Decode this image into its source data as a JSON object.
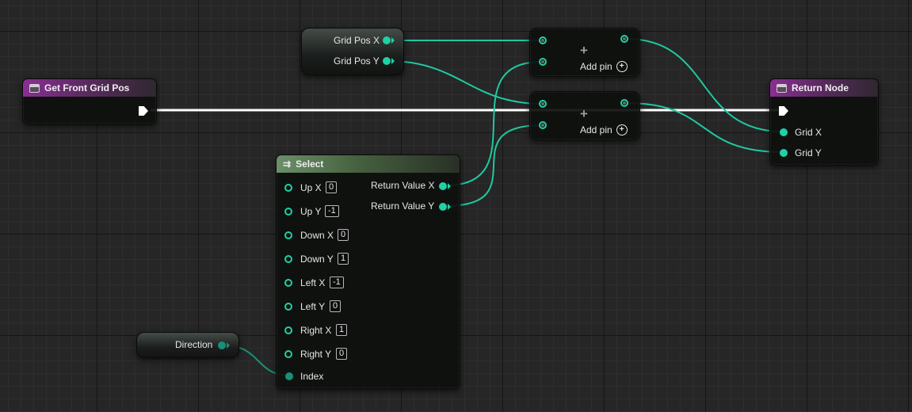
{
  "graph": {
    "colors": {
      "exec_wire": "#ffffff",
      "int_wire": "#1fc9a0",
      "function_header": "#8a2f93",
      "select_header": "#6b8f68"
    }
  },
  "nodes": {
    "get_front_grid_pos": {
      "title": "Get Front Grid Pos",
      "icon": "function-icon"
    },
    "grid_pos_var": {
      "pins": [
        "Grid Pos X",
        "Grid Pos Y"
      ]
    },
    "add_node_1": {
      "add_pin_label": "Add pin",
      "icon": "plus-icon"
    },
    "add_node_2": {
      "add_pin_label": "Add pin",
      "icon": "plus-icon"
    },
    "return_node": {
      "title": "Return Node",
      "icon": "function-icon",
      "pins": [
        "Grid X",
        "Grid Y"
      ]
    },
    "select": {
      "title": "Select",
      "icon": "select-icon",
      "inputs": [
        {
          "label": "Up X",
          "value": "0"
        },
        {
          "label": "Up Y",
          "value": "-1"
        },
        {
          "label": "Down X",
          "value": "0"
        },
        {
          "label": "Down Y",
          "value": "1"
        },
        {
          "label": "Left X",
          "value": "-1"
        },
        {
          "label": "Left Y",
          "value": "0"
        },
        {
          "label": "Right X",
          "value": "1"
        },
        {
          "label": "Right Y",
          "value": "0"
        }
      ],
      "index_label": "Index",
      "outputs": [
        "Return Value X",
        "Return Value Y"
      ]
    },
    "direction_var": {
      "label": "Direction"
    }
  }
}
